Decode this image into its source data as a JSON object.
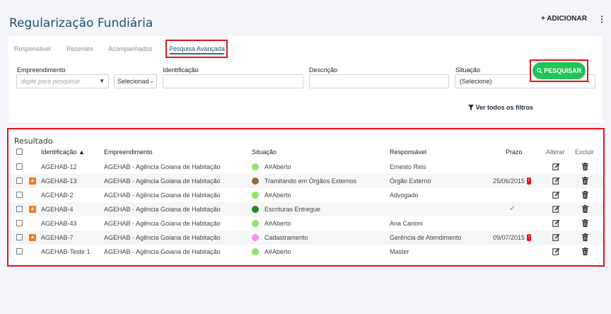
{
  "header": {
    "title": "Regularização Fundiária",
    "add_label": "+ ADICIONAR",
    "more_label": "⋮"
  },
  "tabs": [
    "Responsável",
    "Recentes",
    "Acompanhados",
    "Pesquisa Avançada"
  ],
  "filters": {
    "empreendimento": {
      "label": "Empreendimento",
      "placeholder": "digite para pesquisar",
      "select_value": "Selecionado"
    },
    "identificacao": {
      "label": "Identificação",
      "value": ""
    },
    "descricao": {
      "label": "Descrição",
      "value": ""
    },
    "situacao": {
      "label": "Situação",
      "value": "(Selecione)"
    },
    "all_filters_label": "Ver todos os filtros",
    "search_label": "PESQUISAR"
  },
  "result": {
    "title": "Resultado",
    "columns": [
      "Identificação ▲",
      "Empreendimento",
      "Situação",
      "Responsável",
      "Prazo",
      "Alterar",
      "Excluir"
    ],
    "rows": [
      {
        "id": "AGEHAB-12",
        "emp": "AGEHAB - Agência Goiana de Habitação",
        "sit": "A#Aberto",
        "resp": "Ernesto Reis",
        "prazo": "",
        "flag": false,
        "dot_color": "#8be866",
        "alarm": false,
        "check": false
      },
      {
        "id": "AGEHAB-13",
        "emp": "AGEHAB - Agência Goiana de Habitação",
        "sit": "Tramitando em Órgãos Externos",
        "resp": "Órgão Externo",
        "prazo": "25/06/2015",
        "flag": true,
        "dot_color": "#9a6a3a",
        "alarm": true,
        "check": false
      },
      {
        "id": "AGEHAB-2",
        "emp": "AGEHAB - Agência Goiana de Habitação",
        "sit": "A#Aberto",
        "resp": "Advogado",
        "prazo": "",
        "flag": false,
        "dot_color": "#8be866",
        "alarm": false,
        "check": false
      },
      {
        "id": "AGEHAB-4",
        "emp": "AGEHAB - Agência Goiana de Habitação",
        "sit": "Escrituras Entregue",
        "resp": "",
        "prazo": "",
        "flag": true,
        "dot_color": "#1f8a1f",
        "alarm": false,
        "check": true
      },
      {
        "id": "AGEHAB-43",
        "emp": "AGEHAB - Agência Goiana de Habitação",
        "sit": "A#Aberto",
        "resp": "Ana Carioni",
        "prazo": "",
        "flag": false,
        "dot_color": "#8be866",
        "alarm": false,
        "check": false
      },
      {
        "id": "AGEHAB-7",
        "emp": "AGEHAB - Agência Goiana de Habitação",
        "sit": "Cadastramento",
        "resp": "Gerência de Atendimento",
        "prazo": "09/07/2015",
        "flag": true,
        "dot_color": "#f58cf0",
        "alarm": true,
        "check": false
      },
      {
        "id": "AGEHAB-Teste 1",
        "emp": "AGEHAB - Agência Goiana de Habitação",
        "sit": "A#Aberto",
        "resp": "Master",
        "prazo": "",
        "flag": false,
        "dot_color": "#8be866",
        "alarm": false,
        "check": false
      }
    ]
  },
  "colors": {
    "accent": "#1fc45a",
    "highlight": "#e3141b",
    "title": "#1f4f73"
  },
  "icons": {
    "filter": "filter-icon",
    "search": "search-icon",
    "edit": "edit-icon",
    "delete": "trash-icon",
    "flag": "flag-icon",
    "alarm": "alarm-icon",
    "check": "check-icon"
  }
}
